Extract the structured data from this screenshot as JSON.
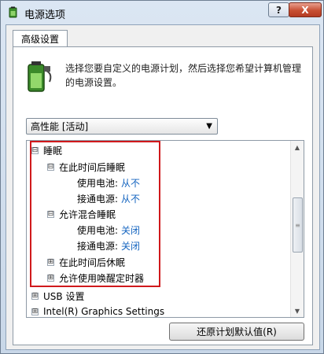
{
  "window": {
    "title": "电源选项",
    "help_label": "?",
    "close_label": "X"
  },
  "tab": {
    "label": "高级设置"
  },
  "description": "选择您要自定义的电源计划，然后选择您希望计算机管理的电源设置。",
  "plan_select": {
    "value": "高性能 [活动]"
  },
  "tree": [
    {
      "label": "睡眠",
      "expander": "⊟"
    },
    {
      "label": "在此时间后睡眠",
      "expander": "⊟"
    },
    {
      "label": "使用电池:",
      "value": "从不"
    },
    {
      "label": "接通电源:",
      "value": "从不"
    },
    {
      "label": "允许混合睡眠",
      "expander": "⊟"
    },
    {
      "label": "使用电池:",
      "value": "关闭"
    },
    {
      "label": "接通电源:",
      "value": "关闭"
    },
    {
      "label": "在此时间后休眠",
      "expander": "⊞"
    },
    {
      "label": "允许使用唤醒定时器",
      "expander": "⊞"
    },
    {
      "label": "USB 设置",
      "expander": "⊞"
    },
    {
      "label": "Intel(R) Graphics Settings",
      "expander": "⊞"
    }
  ],
  "restore_button": {
    "label": "还原计划默认值(R)"
  },
  "colors": {
    "value_text": "#1565c0",
    "highlight_border": "#d0191c",
    "close_button": "#c74f33"
  },
  "icons": {
    "app": "power-options-icon",
    "plan": "battery-plug-icon"
  }
}
